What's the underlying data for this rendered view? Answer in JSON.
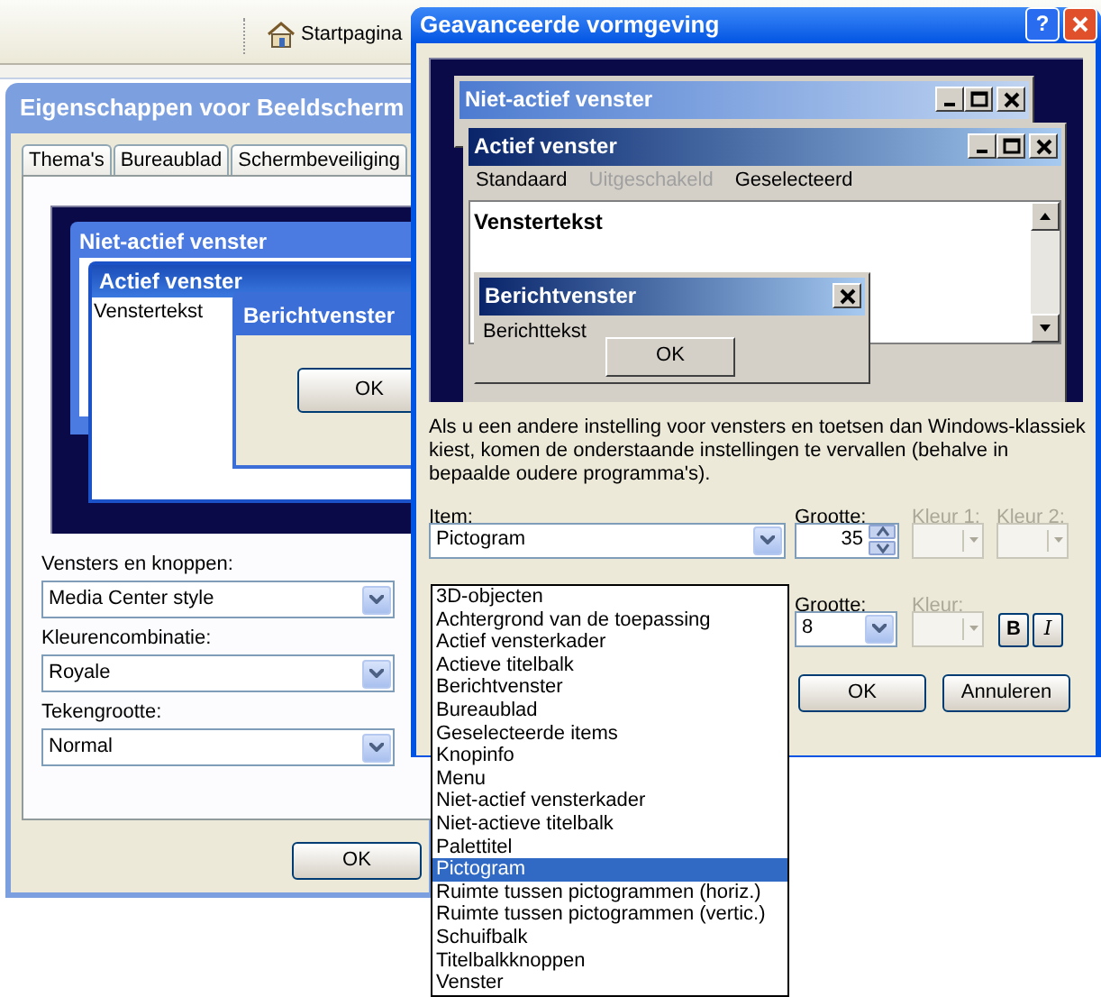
{
  "browser_toolbar": {
    "home_link": "Startpagina"
  },
  "display_properties": {
    "title": "Eigenschappen voor Beeldscherm",
    "tabs": [
      {
        "label": "Thema's",
        "selected": false
      },
      {
        "label": "Bureaublad",
        "selected": false
      },
      {
        "label": "Schermbeveiliging",
        "selected": false
      }
    ],
    "preview": {
      "inactive_title": "Niet-actief venster",
      "active_title": "Actief venster",
      "window_text": "Venstertekst",
      "message_title": "Berichtvenster",
      "ok": "OK"
    },
    "fields": [
      {
        "label": "Vensters en knoppen:",
        "value": "Media Center style"
      },
      {
        "label": "Kleurencombinatie:",
        "value": "Royale"
      },
      {
        "label": "Tekengrootte:",
        "value": "Normal"
      }
    ],
    "ok_button": "OK"
  },
  "advanced_appearance": {
    "title": "Geavanceerde vormgeving",
    "help": "?",
    "preview": {
      "inactive_title": "Niet-actief venster",
      "active_title": "Actief venster",
      "menu": [
        {
          "label": "Standaard",
          "disabled": false
        },
        {
          "label": "Uitgeschakeld",
          "disabled": true
        },
        {
          "label": "Geselecteerd",
          "disabled": false
        }
      ],
      "window_text": "Venstertekst",
      "message_title": "Berichtvenster",
      "message_text": "Berichttekst",
      "ok": "OK"
    },
    "description": "Als u een andere instelling voor vensters en toetsen dan Windows-klassiek kiest, komen de onderstaande instellingen te vervallen (behalve in bepaalde oudere programma's).",
    "item": {
      "label": "Item:",
      "value": "Pictogram",
      "options": [
        {
          "label": "3D-objecten",
          "selected": false
        },
        {
          "label": "Achtergrond van de toepassing",
          "selected": false
        },
        {
          "label": "Actief vensterkader",
          "selected": false
        },
        {
          "label": "Actieve titelbalk",
          "selected": false
        },
        {
          "label": "Berichtvenster",
          "selected": false
        },
        {
          "label": "Bureaublad",
          "selected": false
        },
        {
          "label": "Geselecteerde items",
          "selected": false
        },
        {
          "label": "Knopinfo",
          "selected": false
        },
        {
          "label": "Menu",
          "selected": false
        },
        {
          "label": "Niet-actief vensterkader",
          "selected": false
        },
        {
          "label": "Niet-actieve titelbalk",
          "selected": false
        },
        {
          "label": "Palettitel",
          "selected": false
        },
        {
          "label": "Pictogram",
          "selected": true
        },
        {
          "label": "Ruimte tussen pictogrammen (horiz.)",
          "selected": false
        },
        {
          "label": "Ruimte tussen pictogrammen (vertic.)",
          "selected": false
        },
        {
          "label": "Schuifbalk",
          "selected": false
        },
        {
          "label": "Titelbalkknoppen",
          "selected": false
        },
        {
          "label": "Venster",
          "selected": false
        }
      ]
    },
    "size": {
      "label": "Grootte:",
      "value": "35"
    },
    "color1": {
      "label": "Kleur 1:",
      "disabled": true
    },
    "color2": {
      "label": "Kleur 2:",
      "disabled": true
    },
    "font_size": {
      "label": "Grootte:",
      "value": "8"
    },
    "font_color": {
      "label": "Kleur:",
      "disabled": true
    },
    "bold_button": "B",
    "italic_button": "I",
    "buttons": [
      "OK",
      "Annuleren"
    ]
  }
}
